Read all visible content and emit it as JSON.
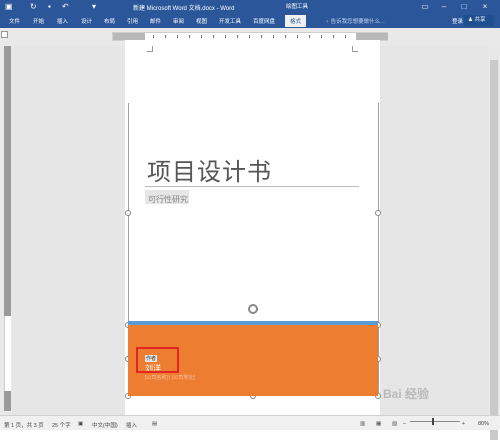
{
  "window": {
    "title": "新建 Microsoft Word 文档.docx - Word",
    "context_title": "绘图工具"
  },
  "ribbon": {
    "tabs": [
      "文件",
      "开始",
      "插入",
      "设计",
      "布局",
      "引用",
      "邮件",
      "审阅",
      "视图",
      "开发工具",
      "百度网盘",
      "格式"
    ],
    "active_tab": "格式",
    "tell_me_placeholder": "告诉我您想要做什么...",
    "login": "登录",
    "share": "共享"
  },
  "document": {
    "title": "项目设计书",
    "subtitle": "可行性研究",
    "author_label": "作者",
    "author_name": "刘洋",
    "company_line": "[公司名称] | [公司地址]"
  },
  "status": {
    "page": "第 1 页，共 3 页",
    "words": "25 个字",
    "language": "中文(中国)",
    "mode": "插入",
    "zoom": "80%"
  },
  "colors": {
    "ribbon": "#2b579a",
    "orange_band": "#ed7d31",
    "blue_bar": "#5b9bd5",
    "highlight_box": "#e32424"
  },
  "watermark": "Bai 经验"
}
